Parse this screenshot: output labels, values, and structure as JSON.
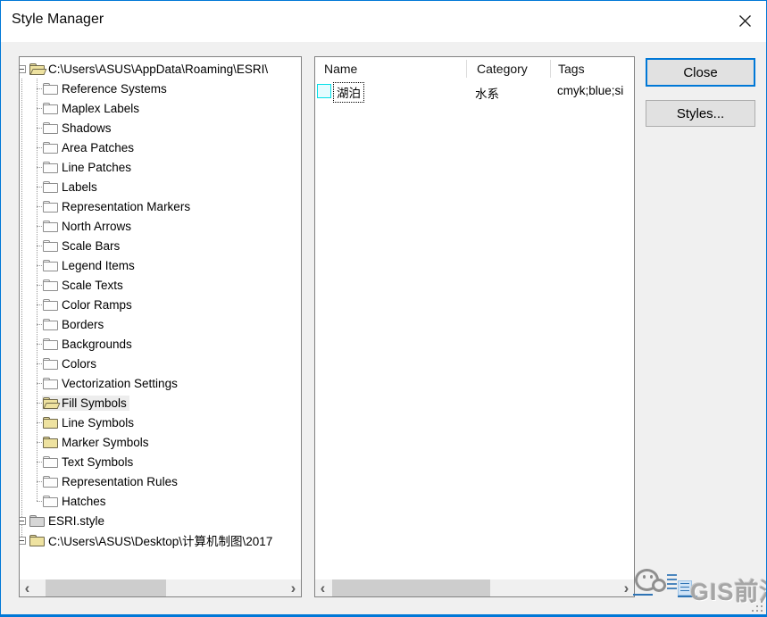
{
  "window": {
    "title": "Style Manager"
  },
  "colors": {
    "accent": "#0078d7",
    "panel_border": "#828282",
    "selection_bg": "#ededed",
    "folder_yellow": "#eee2a0",
    "folder_white": "#fdfdfd",
    "folder_gray": "#d6d6d6",
    "swatch_border": "#00dfe8",
    "swatch_fill": "#e4fcff",
    "scroll_thumb": "#cdcdcd",
    "scroll_track": "#f0f0f0"
  },
  "tree": {
    "items": [
      {
        "label": "C:\\Users\\ASUS\\AppData\\Roaming\\ESRI\\",
        "level": 0,
        "icon": "openyellow",
        "selected": false
      },
      {
        "label": "Reference Systems",
        "level": 1,
        "icon": "white",
        "selected": false
      },
      {
        "label": "Maplex Labels",
        "level": 1,
        "icon": "white",
        "selected": false
      },
      {
        "label": "Shadows",
        "level": 1,
        "icon": "white",
        "selected": false
      },
      {
        "label": "Area Patches",
        "level": 1,
        "icon": "white",
        "selected": false
      },
      {
        "label": "Line Patches",
        "level": 1,
        "icon": "white",
        "selected": false
      },
      {
        "label": "Labels",
        "level": 1,
        "icon": "white",
        "selected": false
      },
      {
        "label": "Representation Markers",
        "level": 1,
        "icon": "white",
        "selected": false
      },
      {
        "label": "North Arrows",
        "level": 1,
        "icon": "white",
        "selected": false
      },
      {
        "label": "Scale Bars",
        "level": 1,
        "icon": "white",
        "selected": false
      },
      {
        "label": "Legend Items",
        "level": 1,
        "icon": "white",
        "selected": false
      },
      {
        "label": "Scale Texts",
        "level": 1,
        "icon": "white",
        "selected": false
      },
      {
        "label": "Color Ramps",
        "level": 1,
        "icon": "white",
        "selected": false
      },
      {
        "label": "Borders",
        "level": 1,
        "icon": "white",
        "selected": false
      },
      {
        "label": "Backgrounds",
        "level": 1,
        "icon": "white",
        "selected": false
      },
      {
        "label": "Colors",
        "level": 1,
        "icon": "white",
        "selected": false
      },
      {
        "label": "Vectorization Settings",
        "level": 1,
        "icon": "white",
        "selected": false
      },
      {
        "label": "Fill Symbols",
        "level": 1,
        "icon": "openyellow",
        "selected": true
      },
      {
        "label": "Line Symbols",
        "level": 1,
        "icon": "yellow",
        "selected": false
      },
      {
        "label": "Marker Symbols",
        "level": 1,
        "icon": "yellow",
        "selected": false
      },
      {
        "label": "Text Symbols",
        "level": 1,
        "icon": "white",
        "selected": false
      },
      {
        "label": "Representation Rules",
        "level": 1,
        "icon": "white",
        "selected": false
      },
      {
        "label": "Hatches",
        "level": 1,
        "icon": "white",
        "selected": false
      },
      {
        "label": "ESRI.style",
        "level": 0,
        "icon": "gray",
        "selected": false
      },
      {
        "label": "C:\\Users\\ASUS\\Desktop\\计算机制图\\2017",
        "level": 0,
        "icon": "yellow",
        "selected": false
      }
    ]
  },
  "list": {
    "columns": [
      {
        "label": "Name"
      },
      {
        "label": "Category"
      },
      {
        "label": "Tags"
      }
    ],
    "rows": [
      {
        "name": "湖泊",
        "category": "水系",
        "tags": "cmyk;blue;si"
      }
    ]
  },
  "buttons": {
    "close": "Close",
    "styles": "Styles..."
  },
  "scrollbars": {
    "left_arrow": "‹",
    "right_arrow": "›"
  },
  "watermark": {
    "text": "GIS前沿"
  }
}
